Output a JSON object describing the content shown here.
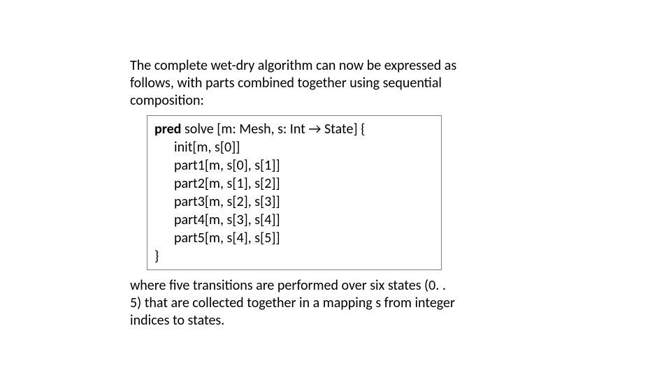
{
  "intro": "The complete wet-dry algorithm can now be expressed as follows, with parts combined together using sequential composition:",
  "code": {
    "kw": "pred",
    "sig": " solve [m: Mesh, s: Int → State] {",
    "lines": [
      "init[m, s[0]]",
      "part1[m, s[0], s[1]]",
      "part2[m, s[1], s[2]]",
      "part3[m, s[2], s[3]]",
      "part4[m, s[3], s[4]]",
      "part5[m, s[4], s[5]]"
    ],
    "close": "}"
  },
  "outro": "where five transitions are performed over six states (0. . 5) that are collected together in a mapping s from integer indices to states."
}
